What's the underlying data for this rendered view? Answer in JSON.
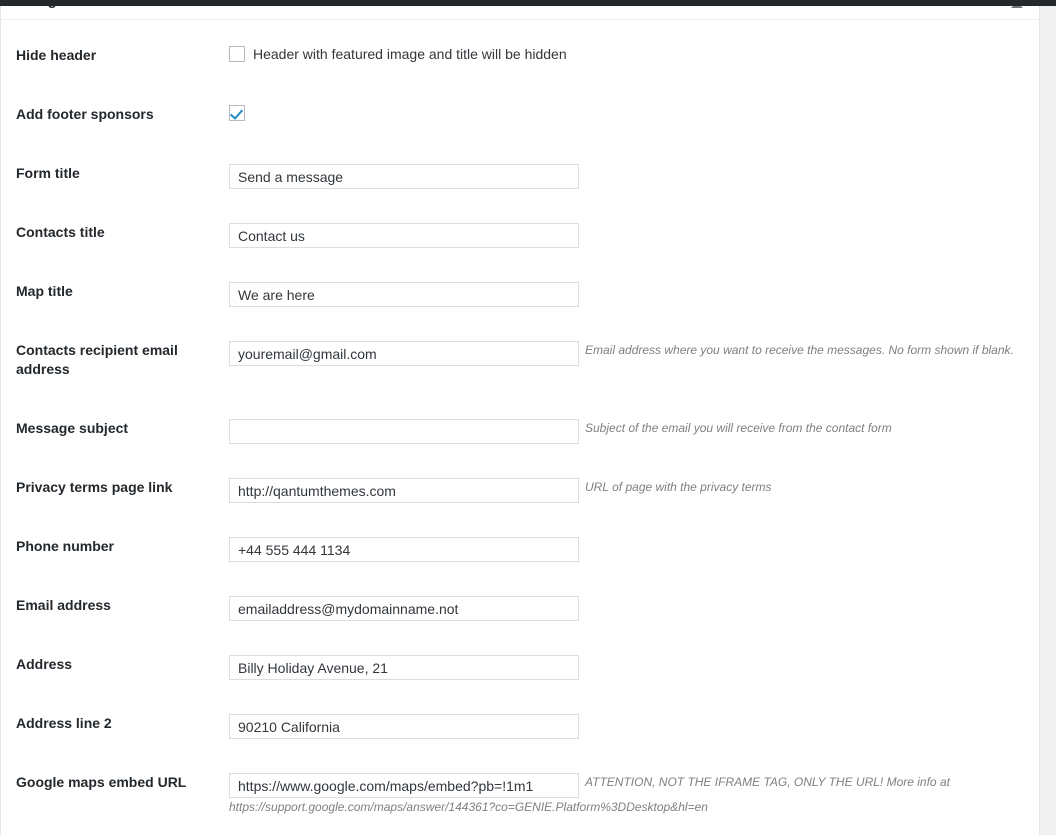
{
  "panel": {
    "title": "Design customization",
    "toggle_icon": "triangle-up-icon"
  },
  "rows": [
    {
      "label": "Hide header",
      "type": "checkbox",
      "checked": false,
      "checkbox_label": "Header with featured image and title will be hidden",
      "description": ""
    },
    {
      "label": "Add footer sponsors",
      "type": "checkbox",
      "checked": true,
      "checkbox_label": "",
      "description": ""
    },
    {
      "label": "Form title",
      "type": "text",
      "value": "Send a message",
      "placeholder": "",
      "description": ""
    },
    {
      "label": "Contacts title",
      "type": "text",
      "value": "Contact us",
      "placeholder": "",
      "description": ""
    },
    {
      "label": "Map title",
      "type": "text",
      "value": "We are here",
      "placeholder": "",
      "description": ""
    },
    {
      "label": "Contacts recipient email address",
      "type": "text",
      "value": "youremail@gmail.com",
      "placeholder": "",
      "description": "Email address where you want to receive the messages. No form shown if blank."
    },
    {
      "label": "Message subject",
      "type": "text",
      "value": "",
      "placeholder": "",
      "description": "Subject of the email you will receive from the contact form"
    },
    {
      "label": "Privacy terms page link",
      "type": "text",
      "value": "http://qantumthemes.com",
      "placeholder": "",
      "description": "URL of page with the privacy terms"
    },
    {
      "label": "Phone number",
      "type": "text",
      "value": "+44 555 444 1134",
      "placeholder": "",
      "description": ""
    },
    {
      "label": "Email address",
      "type": "text",
      "value": "emailaddress@mydomainname.not",
      "placeholder": "",
      "description": ""
    },
    {
      "label": "Address",
      "type": "text",
      "value": "Billy Holiday Avenue, 21",
      "placeholder": "",
      "description": ""
    },
    {
      "label": "Address line 2",
      "type": "text",
      "value": "90210 California",
      "placeholder": "",
      "description": ""
    },
    {
      "label": "Google maps embed URL",
      "type": "text",
      "value": "https://www.google.com/maps/embed?pb=!1m1",
      "placeholder": "",
      "description": "ATTENTION, NOT THE IFRAME TAG, ONLY THE URL! More info at https://support.google.com/maps/answer/144361?co=GENIE.Platform%3DDesktop&hl=en"
    }
  ],
  "colors": {
    "accent": "#1e8cbe",
    "panel_bg": "#ffffff",
    "page_bg": "#f1f1f1",
    "adminbar": "#23282d",
    "label_text": "#23282d",
    "desc_text": "#7f7f7f",
    "input_border": "#dddddd"
  }
}
